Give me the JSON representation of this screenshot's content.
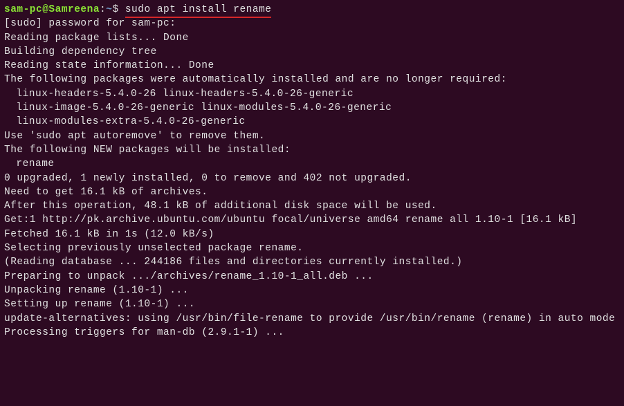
{
  "prompt": {
    "user_host": "sam-pc@Samreena",
    "separator": ":",
    "path": "~",
    "symbol": "$",
    "command": "sudo apt install rename"
  },
  "output": [
    {
      "text": "[sudo] password for sam-pc:",
      "indent": false
    },
    {
      "text": "Reading package lists... Done",
      "indent": false
    },
    {
      "text": "Building dependency tree",
      "indent": false
    },
    {
      "text": "Reading state information... Done",
      "indent": false
    },
    {
      "text": "The following packages were automatically installed and are no longer required:",
      "indent": false
    },
    {
      "text": "linux-headers-5.4.0-26 linux-headers-5.4.0-26-generic",
      "indent": true
    },
    {
      "text": "linux-image-5.4.0-26-generic linux-modules-5.4.0-26-generic",
      "indent": true
    },
    {
      "text": "linux-modules-extra-5.4.0-26-generic",
      "indent": true
    },
    {
      "text": "Use 'sudo apt autoremove' to remove them.",
      "indent": false
    },
    {
      "text": "The following NEW packages will be installed:",
      "indent": false
    },
    {
      "text": "rename",
      "indent": true
    },
    {
      "text": "0 upgraded, 1 newly installed, 0 to remove and 402 not upgraded.",
      "indent": false
    },
    {
      "text": "Need to get 16.1 kB of archives.",
      "indent": false
    },
    {
      "text": "After this operation, 48.1 kB of additional disk space will be used.",
      "indent": false
    },
    {
      "text": "Get:1 http://pk.archive.ubuntu.com/ubuntu focal/universe amd64 rename all 1.10-1 [16.1 kB]",
      "indent": false
    },
    {
      "text": "Fetched 16.1 kB in 1s (12.0 kB/s)",
      "indent": false
    },
    {
      "text": "Selecting previously unselected package rename.",
      "indent": false
    },
    {
      "text": "(Reading database ... 244186 files and directories currently installed.)",
      "indent": false
    },
    {
      "text": "Preparing to unpack .../archives/rename_1.10-1_all.deb ...",
      "indent": false
    },
    {
      "text": "Unpacking rename (1.10-1) ...",
      "indent": false
    },
    {
      "text": "Setting up rename (1.10-1) ...",
      "indent": false
    },
    {
      "text": "update-alternatives: using /usr/bin/file-rename to provide /usr/bin/rename (rename) in auto mode",
      "indent": false
    },
    {
      "text": "Processing triggers for man-db (2.9.1-1) ...",
      "indent": false
    }
  ]
}
